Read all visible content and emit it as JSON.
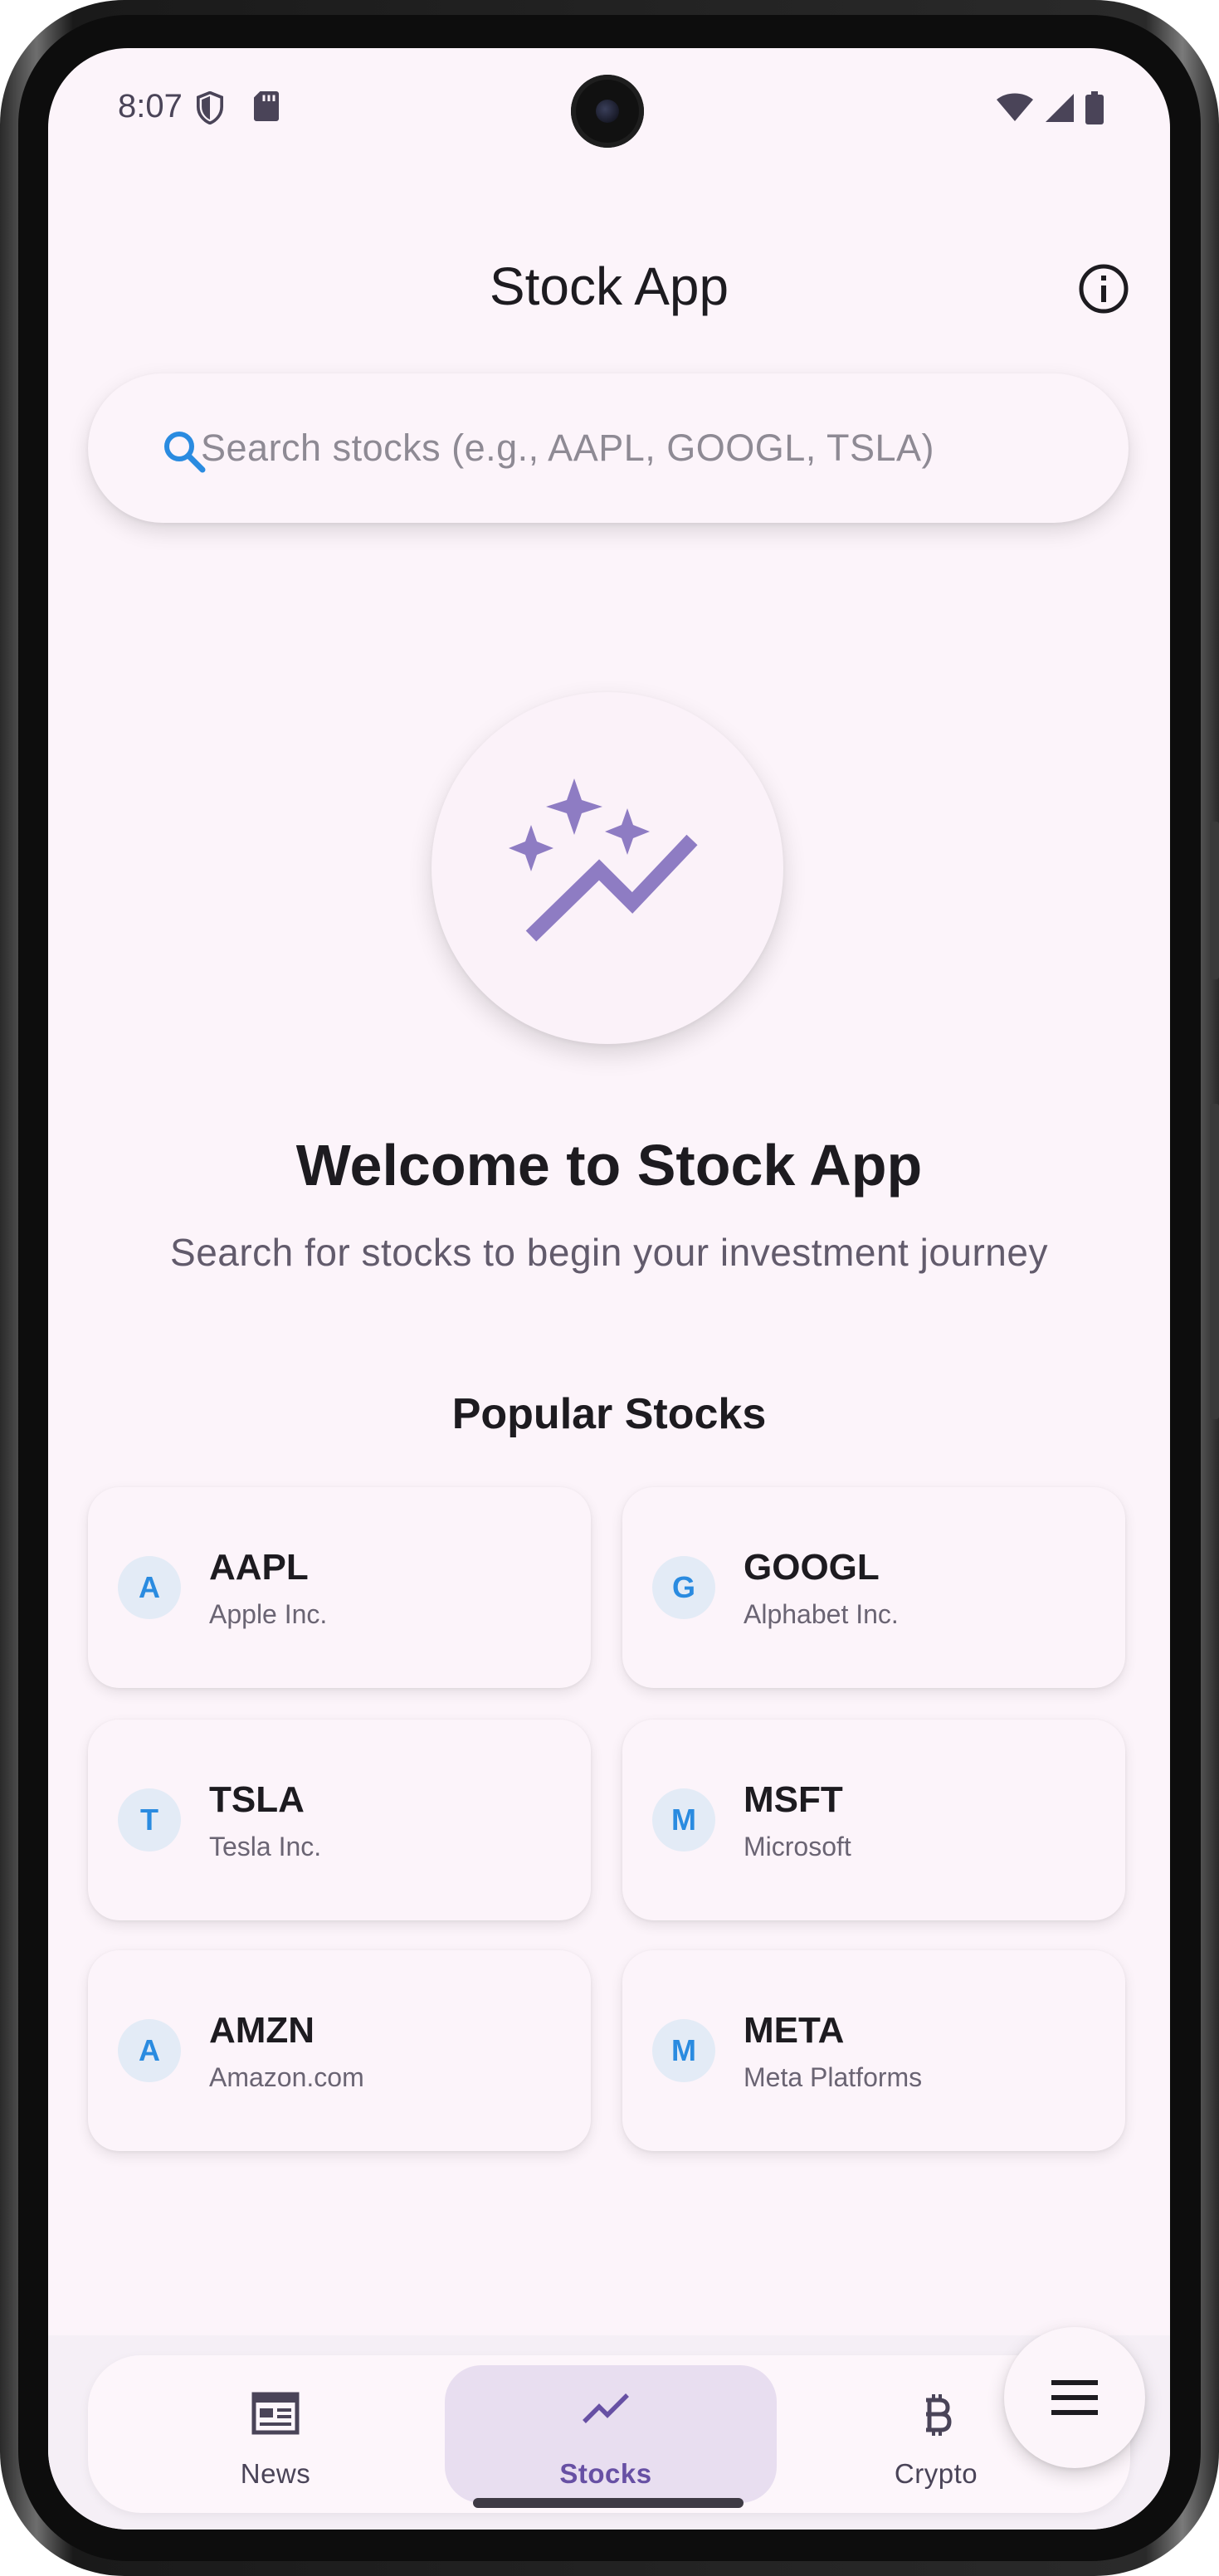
{
  "status_bar": {
    "time": "8:07"
  },
  "app_bar": {
    "title": "Stock App",
    "info_icon": "info-icon"
  },
  "search": {
    "placeholder": "Search stocks (e.g., AAPL, GOOGL, TSLA)",
    "value": "",
    "icon": "search-icon"
  },
  "hero": {
    "icon": "auto-graph-icon",
    "title": "Welcome to Stock App",
    "subtitle": "Search for stocks to begin your investment journey"
  },
  "popular": {
    "title": "Popular Stocks",
    "stocks": [
      {
        "initial": "A",
        "symbol": "AAPL",
        "name": "Apple Inc."
      },
      {
        "initial": "G",
        "symbol": "GOOGL",
        "name": "Alphabet Inc."
      },
      {
        "initial": "T",
        "symbol": "TSLA",
        "name": "Tesla Inc."
      },
      {
        "initial": "M",
        "symbol": "MSFT",
        "name": "Microsoft"
      },
      {
        "initial": "A",
        "symbol": "AMZN",
        "name": "Amazon.com"
      },
      {
        "initial": "M",
        "symbol": "META",
        "name": "Meta Platforms"
      }
    ]
  },
  "bottom_nav": {
    "items": [
      {
        "label": "News",
        "icon": "newspaper-icon"
      },
      {
        "label": "Stocks",
        "icon": "trending-up-icon",
        "selected": true
      },
      {
        "label": "Crypto",
        "icon": "bitcoin-icon"
      }
    ]
  },
  "fab": {
    "icon": "menu-icon"
  },
  "colors": {
    "accent": "#6750a4",
    "icon_purple": "#8e7cc3",
    "avatar_text": "#2a8be0",
    "background": "#fcf4fa"
  }
}
